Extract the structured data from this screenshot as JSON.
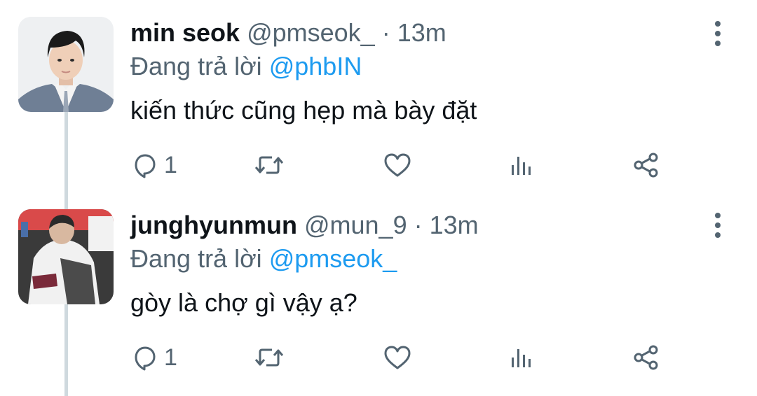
{
  "tweets": [
    {
      "name": "min seok",
      "handle": "@pmseok_",
      "separator": "·",
      "time": "13m",
      "reply_prefix": "Đang trả lời",
      "reply_to": "@phbIN",
      "text": "kiến thức cũng hẹp mà bày đặt",
      "reply_count": "1",
      "icons": [
        "reply-icon",
        "retweet-icon",
        "like-icon",
        "views-icon",
        "share-icon",
        "more-icon"
      ]
    },
    {
      "name": "junghyunmun",
      "handle": "@mun_9",
      "separator": "·",
      "time": "13m",
      "reply_prefix": "Đang trả lời",
      "reply_to": "@pmseok_",
      "text": "gòy là chợ gì vậy ạ?",
      "reply_count": "1",
      "icons": [
        "reply-icon",
        "retweet-icon",
        "like-icon",
        "views-icon",
        "share-icon",
        "more-icon"
      ]
    }
  ],
  "colors": {
    "text_primary": "#0f1419",
    "text_secondary": "#536471",
    "link": "#1d9bf0",
    "thread_line": "#cfd9de"
  }
}
